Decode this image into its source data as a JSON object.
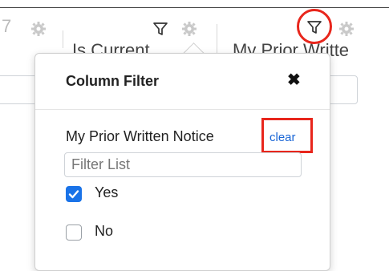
{
  "grid_header": {
    "partial_left_glyph": "7",
    "col_is_current_label": "Is Current",
    "col_prior_written_label": "My Prior Writte"
  },
  "icons": {
    "gear": "gear-icon",
    "funnel": "funnel-filter-icon",
    "close": "close-x-icon",
    "check": "checkmark-icon"
  },
  "column_filter": {
    "title": "Column Filter",
    "close_glyph": "✖",
    "field_label": "My Prior Written Notice",
    "clear_label": "clear",
    "search_placeholder": "Filter List",
    "search_value": "",
    "options": [
      {
        "label": "Yes",
        "checked": true
      },
      {
        "label": "No",
        "checked": false
      }
    ]
  },
  "colors": {
    "highlight": "#e8261c",
    "link": "#1a66d6",
    "checkbox_checked": "#1a73e8"
  }
}
